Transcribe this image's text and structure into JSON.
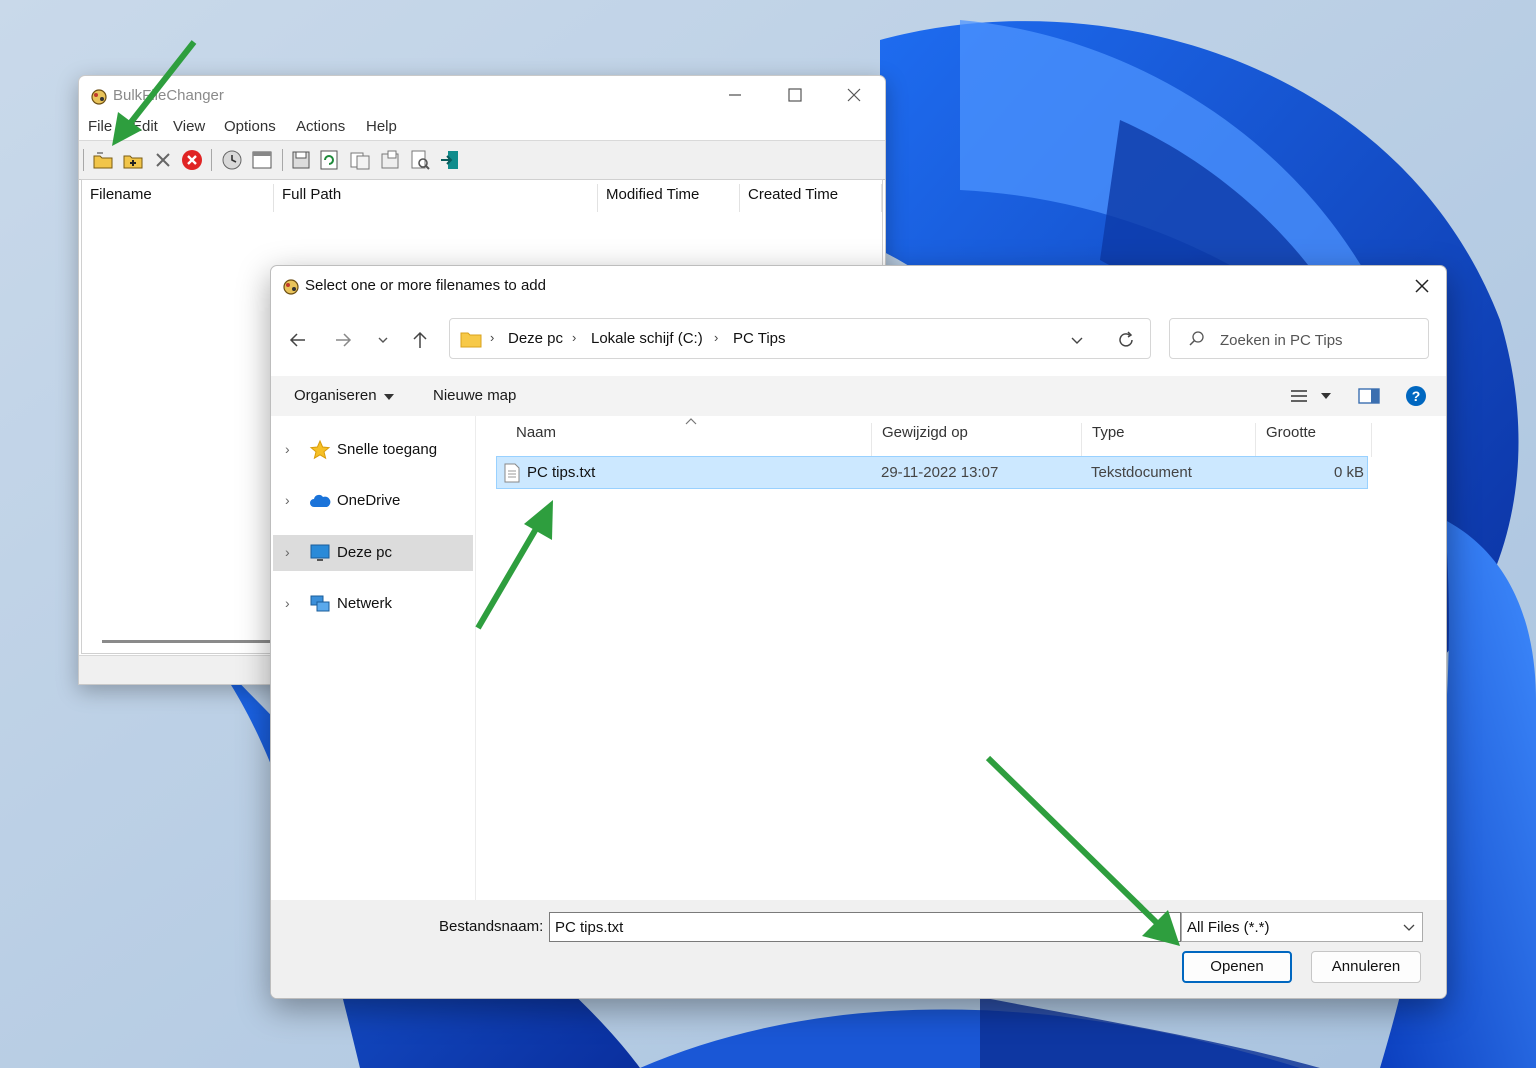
{
  "bulkfilechanger": {
    "title": "BulkFileChanger",
    "menu": [
      "File",
      "Edit",
      "View",
      "Options",
      "Actions",
      "Help"
    ],
    "toolbar_icons": [
      "add-files-icon",
      "add-folder-icon",
      "remove-icon",
      "clear-list-icon",
      "time-icon",
      "properties-window-icon",
      "save-icon",
      "refresh-icon",
      "copy-icon",
      "file-properties-icon",
      "find-icon",
      "exit-icon"
    ],
    "columns": [
      "Filename",
      "Full Path",
      "Modified Time",
      "Created Time"
    ]
  },
  "dialog": {
    "title": "Select one or more  filenames to add",
    "breadcrumb": [
      "Deze pc",
      "Lokale schijf (C:)",
      "PC Tips"
    ],
    "search_placeholder": "Zoeken in PC Tips",
    "commands": {
      "organize": "Organiseren",
      "new_folder": "Nieuwe map"
    },
    "nav": [
      {
        "label": "Snelle toegang",
        "icon": "star-icon"
      },
      {
        "label": "OneDrive",
        "icon": "cloud-icon"
      },
      {
        "label": "Deze pc",
        "icon": "monitor-icon",
        "selected": true
      },
      {
        "label": "Netwerk",
        "icon": "network-icon"
      }
    ],
    "columns": [
      "Naam",
      "Gewijzigd op",
      "Type",
      "Grootte"
    ],
    "files": [
      {
        "name": "PC tips.txt",
        "modified": "29-11-2022 13:07",
        "type": "Tekstdocument",
        "size": "0 kB",
        "selected": true
      }
    ],
    "filename_label": "Bestandsnaam:",
    "filename_value": "PC tips.txt",
    "filter": "All Files (*.*)",
    "open_button": "Openen",
    "cancel_button": "Annuleren"
  },
  "colors": {
    "accent": "#0067c0",
    "annotation_arrow": "#2e9e3e",
    "selection": "#cce8ff"
  }
}
